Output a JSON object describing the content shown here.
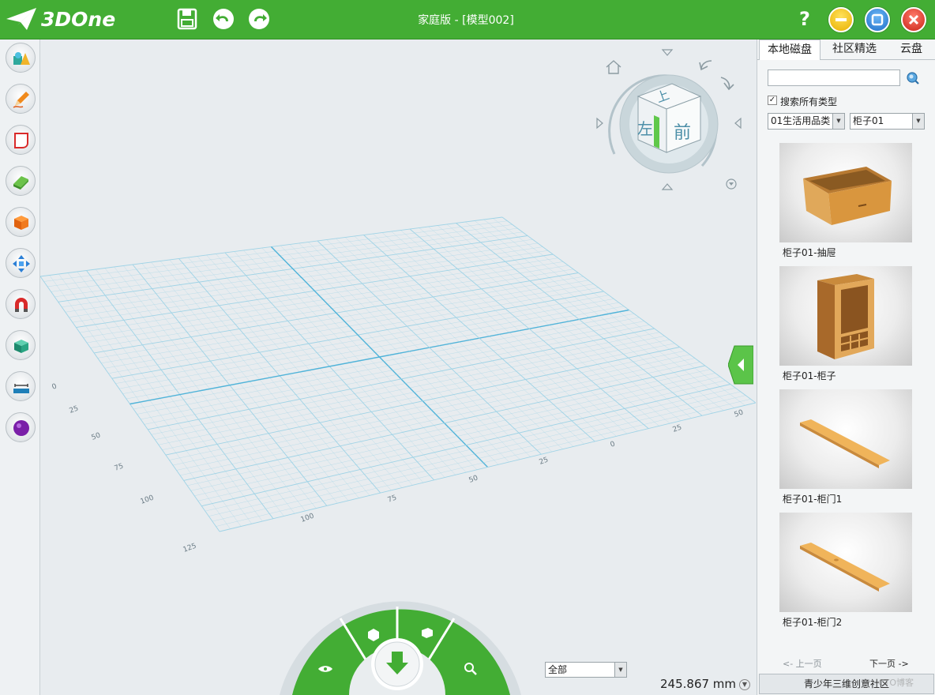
{
  "app": {
    "brand": "3DOne",
    "title": "家庭版 - [模型002]",
    "help": "?"
  },
  "colors": {
    "titlebar": "#43ad34",
    "minimize": "#f2c20d",
    "maximize": "#2f8fe4",
    "close": "#e23b2f",
    "grid": "#9fd3e6"
  },
  "toolbar": {
    "icons": [
      "save-icon",
      "undo-icon",
      "redo-icon"
    ]
  },
  "left_tools": [
    "basic-shapes-icon",
    "sketch-pencil-icon",
    "sketch-edit-icon",
    "feature-modify-icon",
    "special-function-icon",
    "basic-edit-icon",
    "magnet-adsorb-icon",
    "combine-icon",
    "distance-measure-icon",
    "material-render-icon"
  ],
  "viewcube": {
    "top": "上",
    "left": "左",
    "front": "前"
  },
  "viewport": {
    "axis_labels_left": [
      "0",
      "25",
      "50",
      "75",
      "100",
      "125"
    ],
    "axis_labels_bottom": [
      "25",
      "50",
      "75",
      "100",
      "0",
      "25",
      "50"
    ],
    "measurement": "245.867 mm",
    "filter_value": "全部"
  },
  "panel": {
    "tabs": [
      "本地磁盘",
      "社区精选",
      "云盘"
    ],
    "active_tab": 0,
    "search_value": "",
    "checkbox_label": "搜索所有类型",
    "checkbox_checked": true,
    "category_select": "01生活用品类",
    "subcategory_select": "柜子01",
    "items": [
      {
        "label": "柜子01-抽屉"
      },
      {
        "label": "柜子01-柜子"
      },
      {
        "label": "柜子01-柜门1"
      },
      {
        "label": "柜子01-柜门2"
      }
    ],
    "prev_page": "<- 上一页",
    "next_page": "下一页 ->",
    "community_button": "青少年三维创意社区"
  },
  "watermark": "CTO博客"
}
